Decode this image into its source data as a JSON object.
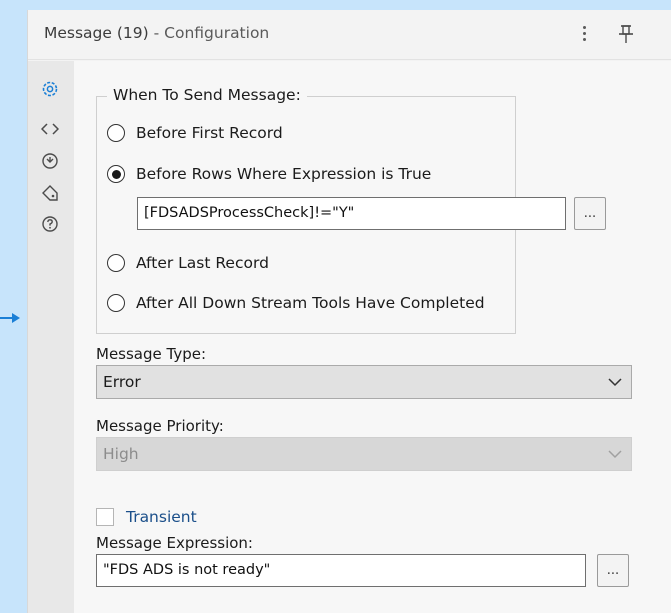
{
  "panel": {
    "title_main": "Message (19)",
    "title_sub": " - Configuration"
  },
  "sidebar": {
    "icons": [
      "gear-icon",
      "code-icon",
      "navigate-icon",
      "tag-icon",
      "help-icon"
    ]
  },
  "when_to_send": {
    "legend": "When To Send Message:",
    "options": [
      {
        "label": "Before First Record",
        "selected": false
      },
      {
        "label": "Before Rows Where Expression is True",
        "selected": true
      },
      {
        "label": "After Last Record",
        "selected": false
      },
      {
        "label": "After All Down Stream Tools Have Completed",
        "selected": false
      }
    ],
    "expression_value": "[FDSADSProcessCheck]!=\"Y\"",
    "expression_button": "..."
  },
  "message_type": {
    "label": "Message Type:",
    "value": "Error"
  },
  "message_priority": {
    "label": "Message Priority:",
    "value": "High"
  },
  "transient": {
    "label": "Transient",
    "checked": false
  },
  "message_expression": {
    "label": "Message Expression:",
    "value": "\"FDS ADS is not ready\"",
    "button": "..."
  },
  "colors": {
    "accent": "#1a7fd6",
    "background": "#c7e4fb"
  }
}
